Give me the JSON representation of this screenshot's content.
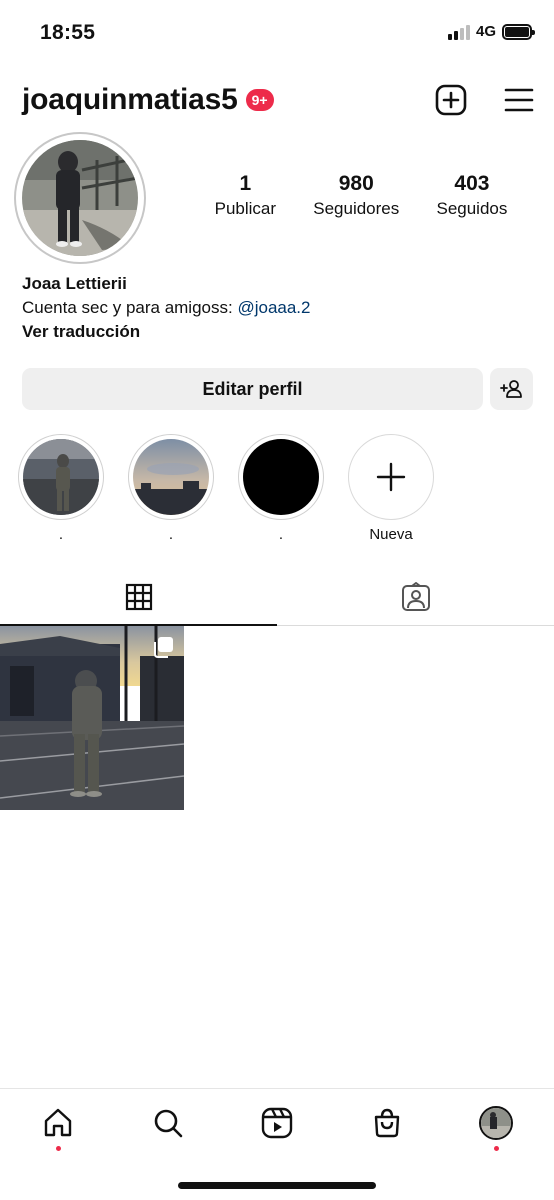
{
  "status_bar": {
    "time": "18:55",
    "network": "4G"
  },
  "header": {
    "username": "joaquinmatias5",
    "notification_badge": "9+"
  },
  "stats": [
    {
      "value": "1",
      "label": "Publicar"
    },
    {
      "value": "980",
      "label": "Seguidores"
    },
    {
      "value": "403",
      "label": "Seguidos"
    }
  ],
  "bio": {
    "name": "Joaa Lettierii",
    "text": "Cuenta sec y para amigoss: ",
    "mention": "@joaaa.2",
    "translate": "Ver traducción"
  },
  "buttons": {
    "edit_profile": "Editar perfil"
  },
  "highlights": [
    {
      "label": "."
    },
    {
      "label": "."
    },
    {
      "label": "."
    },
    {
      "label": "Nueva"
    }
  ],
  "colors": {
    "badge": "#ed2b4a",
    "mention": "#00376b",
    "button_bg": "#efefef"
  }
}
